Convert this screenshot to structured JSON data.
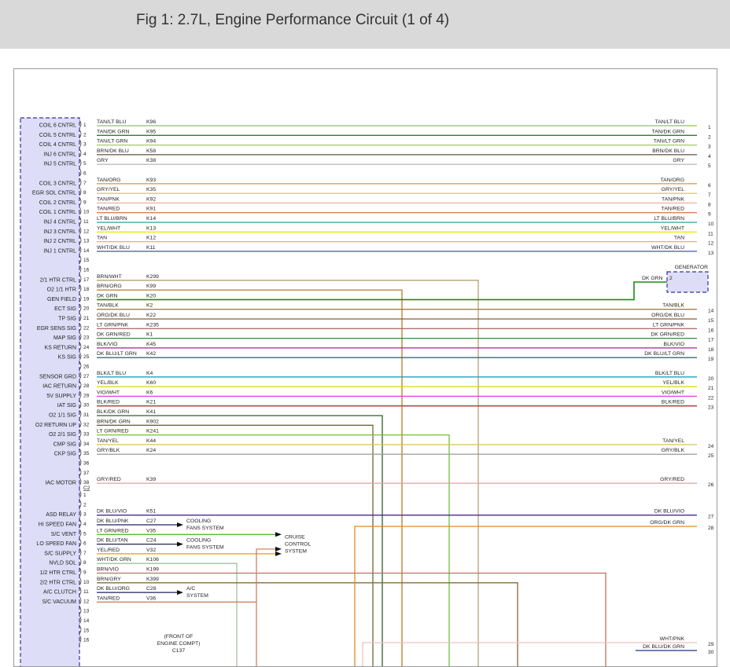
{
  "title": "Fig 1: 2.7L, Engine Performance Circuit (1 of 4)",
  "connector_c2_label": "C2",
  "colors": {
    "module_fill": "#ddddf7",
    "module_border": "#333399",
    "label_text": "#222222"
  },
  "left_pins": [
    {
      "pin": "1",
      "label": "COIL 6 CNTRL",
      "wire": "TAN/LT BLU",
      "circuit": "K96",
      "color": "#8dc63f"
    },
    {
      "pin": "2",
      "label": "COIL 5 CNTRL",
      "wire": "TAN/DK GRN",
      "circuit": "K95",
      "color": "#2e7d32"
    },
    {
      "pin": "3",
      "label": "COIL 4 CNTRL",
      "wire": "TAN/LT GRN",
      "circuit": "K94",
      "color": "#9ccc65"
    },
    {
      "pin": "4",
      "label": "INJ 6 CNTRL",
      "wire": "BRN/DK BLU",
      "circuit": "K58",
      "color": "#6d4c41"
    },
    {
      "pin": "5",
      "label": "INJ 5 CNTRL",
      "wire": "GRY",
      "circuit": "K38",
      "color": "#bdbdbd"
    },
    {
      "pin": "6",
      "label": "",
      "wire": "",
      "circuit": "",
      "color": ""
    },
    {
      "pin": "7",
      "label": "COIL 3 CNTRL",
      "wire": "TAN/ORG",
      "circuit": "K93",
      "color": "#e0a050"
    },
    {
      "pin": "8",
      "label": "EGR SOL CNTRL",
      "wire": "GRY/YEL",
      "circuit": "K35",
      "color": "#d4c94a"
    },
    {
      "pin": "9",
      "label": "COIL 2 CNTRL",
      "wire": "TAN/PNK",
      "circuit": "K92",
      "color": "#e8b0a0"
    },
    {
      "pin": "10",
      "label": "COIL 1 CNTRL",
      "wire": "TAN/RED",
      "circuit": "K91",
      "color": "#d98060"
    },
    {
      "pin": "11",
      "label": "INJ 4 CNTRL",
      "wire": "LT BLU/BRN",
      "circuit": "K14",
      "color": "#26a0a0"
    },
    {
      "pin": "12",
      "label": "INJ 3 CNTRL",
      "wire": "YEL/WHT",
      "circuit": "K13",
      "color": "#f2e600"
    },
    {
      "pin": "13",
      "label": "INJ 2 CNTRL",
      "wire": "TAN",
      "circuit": "K12",
      "color": "#d2b48c"
    },
    {
      "pin": "14",
      "label": "INJ 1 CNTRL",
      "wire": "WHT/DK BLU",
      "circuit": "K11",
      "color": "#3f51b5"
    },
    {
      "pin": "15",
      "label": "",
      "wire": "",
      "circuit": "",
      "color": ""
    },
    {
      "pin": "16",
      "label": "",
      "wire": "",
      "circuit": "",
      "color": ""
    },
    {
      "pin": "17",
      "label": "2/1 HTR CTRL",
      "wire": "BRN/WHT",
      "circuit": "K299",
      "color": "#b8a070"
    },
    {
      "pin": "18",
      "label": "O2 1/1 HTR",
      "wire": "BRN/ORG",
      "circuit": "K99",
      "color": "#c07820"
    },
    {
      "pin": "19",
      "label": "GEN FIELD",
      "wire": "DK GRN",
      "circuit": "K20",
      "color": "#1a8a1a"
    },
    {
      "pin": "20",
      "label": "ECT SIG",
      "wire": "TAN/BLK",
      "circuit": "K2",
      "color": "#a08050"
    },
    {
      "pin": "21",
      "label": "TP SIG",
      "wire": "ORG/DK BLU",
      "circuit": "K22",
      "color": "#8a5a30"
    },
    {
      "pin": "22",
      "label": "EGR SENS SIG",
      "wire": "LT GRN/PNK",
      "circuit": "K235",
      "color": "#b07070"
    },
    {
      "pin": "23",
      "label": "MAP SIG",
      "wire": "DK GRN/RED",
      "circuit": "K1",
      "color": "#3a8a3a"
    },
    {
      "pin": "24",
      "label": "KS RETURN",
      "wire": "BLK/VIO",
      "circuit": "K45",
      "color": "#a020a0"
    },
    {
      "pin": "25",
      "label": "KS SIG",
      "wire": "DK BLU/LT GRN",
      "circuit": "K42",
      "color": "#3a6a7a"
    },
    {
      "pin": "26",
      "label": "",
      "wire": "",
      "circuit": "",
      "color": ""
    },
    {
      "pin": "27",
      "label": "SENSOR GRD",
      "wire": "BLK/LT BLU",
      "circuit": "K4",
      "color": "#20a0c0"
    },
    {
      "pin": "28",
      "label": "IAC RETURN",
      "wire": "YEL/BLK",
      "circuit": "K60",
      "color": "#e0d000"
    },
    {
      "pin": "29",
      "label": "5V SUPPLY",
      "wire": "VIO/WHT",
      "circuit": "K6",
      "color": "#e040e0"
    },
    {
      "pin": "30",
      "label": "IAT SIG",
      "wire": "BLK/RED",
      "circuit": "K21",
      "color": "#b03030"
    },
    {
      "pin": "31",
      "label": "O2 1/1 SIG",
      "wire": "BLK/DK GRN",
      "circuit": "K41",
      "color": "#2e5e2e"
    },
    {
      "pin": "32",
      "label": "O2 RETURN UP",
      "wire": "BRN/DK GRN",
      "circuit": "K902",
      "color": "#6a6a30"
    },
    {
      "pin": "33",
      "label": "O2 2/1 SIG",
      "wire": "LT GRN/RED",
      "circuit": "K241",
      "color": "#70c040"
    },
    {
      "pin": "34",
      "label": "CMP SIG",
      "wire": "TAN/YEL",
      "circuit": "K44",
      "color": "#d8c060"
    },
    {
      "pin": "35",
      "label": "CKP SIG",
      "wire": "GRY/BLK",
      "circuit": "K24",
      "color": "#a0a0a0"
    },
    {
      "pin": "36",
      "label": "",
      "wire": "",
      "circuit": "",
      "color": ""
    },
    {
      "pin": "37",
      "label": "",
      "wire": "",
      "circuit": "",
      "color": ""
    },
    {
      "pin": "38",
      "label": "IAC MOTOR",
      "wire": "GRY/RED",
      "circuit": "K39",
      "color": "#e0a0a0"
    }
  ],
  "c2_pins": [
    {
      "pin": "1",
      "label": "",
      "wire": "",
      "circuit": "",
      "color": ""
    },
    {
      "pin": "2",
      "label": "",
      "wire": "",
      "circuit": "",
      "color": ""
    },
    {
      "pin": "3",
      "label": "ASD RELAY",
      "wire": "DK BLU/VIO",
      "circuit": "K51",
      "color": "#4a2a8a"
    },
    {
      "pin": "4",
      "label": "HI SPEED FAN",
      "wire": "DK BLU/PNK",
      "circuit": "C27",
      "color": "#202060"
    },
    {
      "pin": "5",
      "label": "S/C VENT",
      "wire": "LT GRN/RED",
      "circuit": "V35",
      "color": "#50c030"
    },
    {
      "pin": "6",
      "label": "LO SPEED FAN",
      "wire": "DK BLU/TAN",
      "circuit": "C24",
      "color": "#202060"
    },
    {
      "pin": "7",
      "label": "S/C SUPPLY",
      "wire": "YEL/RED",
      "circuit": "V32",
      "color": "#e0a000"
    },
    {
      "pin": "8",
      "label": "NVLD SOL",
      "wire": "WHT/DK GRN",
      "circuit": "K106",
      "color": "#a0c0a0"
    },
    {
      "pin": "9",
      "label": "1/2 HTR CTRL",
      "wire": "BRN/VIO",
      "circuit": "K199",
      "color": "#c07060"
    },
    {
      "pin": "10",
      "label": "2/2 HTR CTRL",
      "wire": "BRN/GRY",
      "circuit": "K399",
      "color": "#8a6a3a"
    },
    {
      "pin": "11",
      "label": "A/C CLUTCH",
      "wire": "DK BLU/ORG",
      "circuit": "C28",
      "color": "#202060"
    },
    {
      "pin": "12",
      "label": "S/C VACUUM",
      "wire": "TAN/RED",
      "circuit": "V36",
      "color": "#d08060"
    },
    {
      "pin": "13",
      "label": "",
      "wire": "",
      "circuit": "",
      "color": ""
    },
    {
      "pin": "14",
      "label": "",
      "wire": "",
      "circuit": "",
      "color": ""
    },
    {
      "pin": "15",
      "label": "",
      "wire": "",
      "circuit": "",
      "color": ""
    },
    {
      "pin": "16",
      "label": "",
      "wire": "",
      "circuit": "",
      "color": ""
    }
  ],
  "right_wires": [
    {
      "num": "1",
      "wire": "TAN/LT BLU"
    },
    {
      "num": "2",
      "wire": "TAN/DK GRN"
    },
    {
      "num": "3",
      "wire": "TAN/LT GRN"
    },
    {
      "num": "4",
      "wire": "BRN/DK BLU"
    },
    {
      "num": "5",
      "wire": "GRY"
    },
    {
      "num": "6",
      "wire": "TAN/ORG"
    },
    {
      "num": "7",
      "wire": "GRY/YEL"
    },
    {
      "num": "8",
      "wire": "TAN/PNK"
    },
    {
      "num": "9",
      "wire": "TAN/RED"
    },
    {
      "num": "10",
      "wire": "LT BLU/BRN"
    },
    {
      "num": "11",
      "wire": "YEL/WHT"
    },
    {
      "num": "12",
      "wire": "TAN"
    },
    {
      "num": "13",
      "wire": "WHT/DK BLU"
    },
    {
      "num": "14",
      "wire": "TAN/BLK"
    },
    {
      "num": "15",
      "wire": "ORG/DK BLU"
    },
    {
      "num": "16",
      "wire": "LT GRN/PNK"
    },
    {
      "num": "17",
      "wire": "DK GRN/RED"
    },
    {
      "num": "18",
      "wire": "BLK/VIO"
    },
    {
      "num": "19",
      "wire": "DK BLU/LT GRN"
    },
    {
      "num": "20",
      "wire": "BLK/LT BLU"
    },
    {
      "num": "21",
      "wire": "YEL/BLK"
    },
    {
      "num": "22",
      "wire": "VIO/WHT"
    },
    {
      "num": "23",
      "wire": "BLK/RED"
    },
    {
      "num": "24",
      "wire": "TAN/YEL"
    },
    {
      "num": "25",
      "wire": "GRY/BLK"
    },
    {
      "num": "26",
      "wire": "GRY/RED"
    },
    {
      "num": "27",
      "wire": "DK BLU/VIO"
    },
    {
      "num": "28",
      "wire": "ORG/DK GRN"
    },
    {
      "num": "29",
      "wire": "WHT/PNK"
    },
    {
      "num": "30",
      "wire": "DK BLU/DK GRN"
    }
  ],
  "generator": {
    "label": "GENERATOR",
    "wire": "DK GRN",
    "pin": "2"
  },
  "destinations": {
    "cooling_fans_1": [
      "COOLING",
      "FANS SYSTEM"
    ],
    "cooling_fans_2": [
      "COOLING",
      "FANS SYSTEM"
    ],
    "cruise": [
      "CRUISE",
      "CONTROL",
      "SYSTEM"
    ],
    "ac": [
      "A/C",
      "SYSTEM"
    ],
    "front_note": [
      "(FRONT OF",
      "ENGINE COMPT)",
      "C137"
    ]
  }
}
